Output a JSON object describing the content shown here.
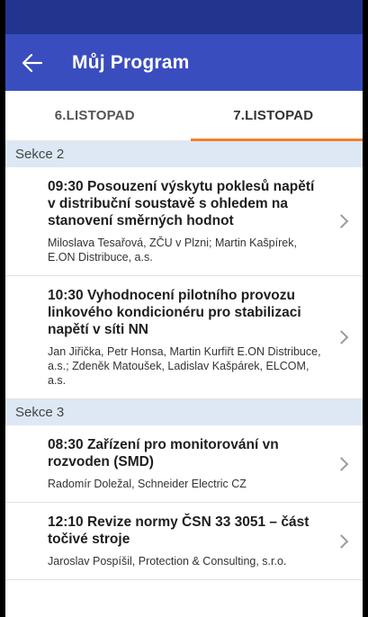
{
  "app_bar": {
    "title": "Můj Program",
    "back_icon": "arrow-left-icon"
  },
  "tabs": [
    {
      "label": "6.LISTOPAD",
      "active": false
    },
    {
      "label": "7.LISTOPAD",
      "active": true
    }
  ],
  "colors": {
    "status_bar": "#22348e",
    "app_bar": "#3a4dbf",
    "tab_indicator": "#f0812c",
    "section_bg": "#dde8f4"
  },
  "sections": [
    {
      "header": "Sekce 2",
      "items": [
        {
          "title": "09:30 Posouzení výskytu poklesů napětí v distribuční soustavě s ohledem na stanovení směrných hodnot",
          "authors": "Miloslava Tesařová, ZČU  v Plzni; Martin Kašpírek, E.ON Distribuce, a.s."
        },
        {
          "title": "10:30 Vyhodnocení pilotního provozu linkového kondicionéru pro stabilizaci napětí v síti NN",
          "authors": "Jan Jiřička, Petr Honsa, Martin Kurfiřt E.ON Distribuce, a.s.; Zdeněk Matoušek, Ladislav Kašpárek, ELCOM, a.s."
        }
      ]
    },
    {
      "header": "Sekce 3",
      "items": [
        {
          "title": "08:30 Zařízení pro monitorování vn rozvoden (SMD)",
          "authors": "Radomír Doležal, Schneider Electric CZ"
        },
        {
          "title": "12:10 Revize normy ČSN 33 3051 – část točivé stroje",
          "authors": "Jaroslav Pospíšil, Protection & Consulting, s.r.o."
        }
      ]
    }
  ]
}
